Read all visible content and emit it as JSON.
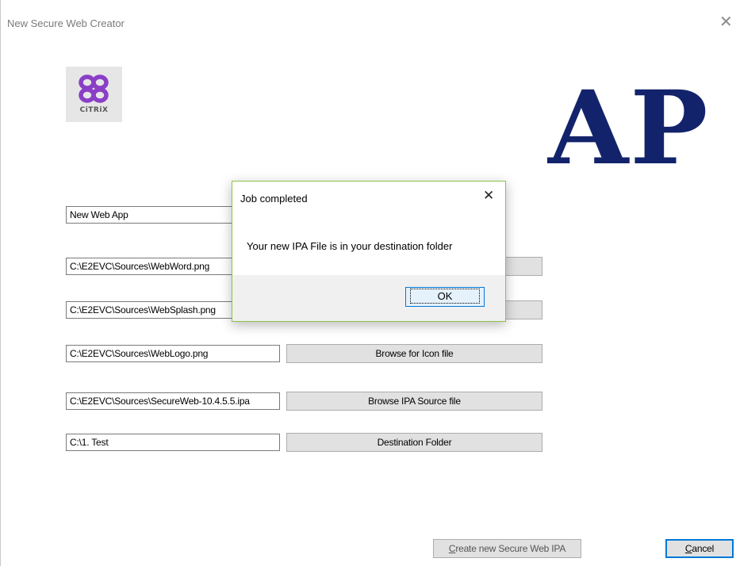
{
  "window": {
    "title": "New Secure Web Creator",
    "close_glyph": "✕"
  },
  "logo": {
    "text": "CiTRiX",
    "icon": "citrix-butterfly-icon",
    "color": "#8a3fc6"
  },
  "brand": {
    "text": "AP",
    "color": "#13236b"
  },
  "fields": {
    "app_name": "New Web App",
    "word_path": "C:\\E2EVC\\Sources\\WebWord.png",
    "splash_path": "C:\\E2EVC\\Sources\\WebSplash.png",
    "logo_path": "C:\\E2EVC\\Sources\\WebLogo.png",
    "ipa_path": "C:\\E2EVC\\Sources\\SecureWeb-10.4.5.5.ipa",
    "dest_path": "C:\\1. Test"
  },
  "buttons": {
    "browse_icon": "Browse for Icon file",
    "browse_ipa": "Browse IPA Source file",
    "destination": "Destination Folder",
    "create_prefix": "C",
    "create_rest": "reate new Secure Web IPA",
    "cancel_prefix": "C",
    "cancel_rest": "ancel"
  },
  "dialog": {
    "title": "Job completed",
    "close_glyph": "✕",
    "message": "Your new IPA File is in your destination folder",
    "ok_label": "OK"
  }
}
